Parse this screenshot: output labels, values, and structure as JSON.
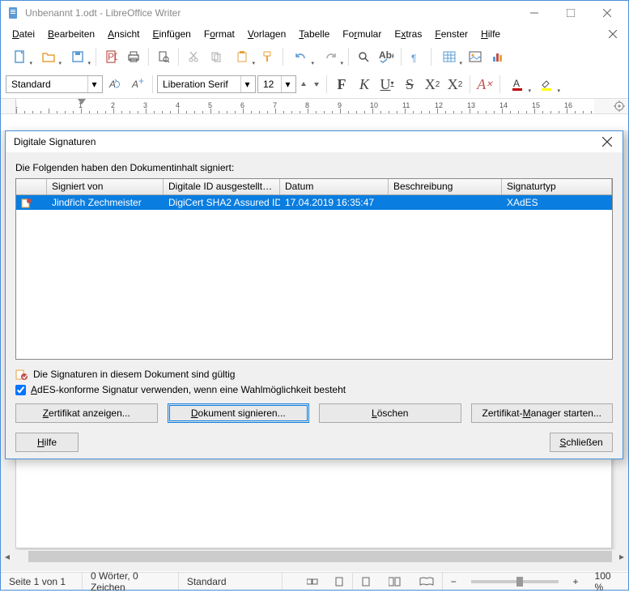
{
  "window": {
    "title": "Unbenannt 1.odt - LibreOffice Writer"
  },
  "menu": {
    "datei": "Datei",
    "bearbeiten": "Bearbeiten",
    "ansicht": "Ansicht",
    "einfuegen": "Einfügen",
    "format": "Format",
    "vorlagen": "Vorlagen",
    "tabelle": "Tabelle",
    "formular": "Formular",
    "extras": "Extras",
    "fenster": "Fenster",
    "hilfe": "Hilfe"
  },
  "formatting": {
    "para_style": "Standard",
    "font_name": "Liberation Serif",
    "font_size": "12"
  },
  "ruler_numbers": [
    "1",
    "",
    "1",
    "2",
    "3",
    "4",
    "5",
    "6",
    "7",
    "8",
    "9",
    "10",
    "11",
    "12",
    "13",
    "14",
    "15",
    "16"
  ],
  "dialog": {
    "title": "Digitale Signaturen",
    "intro": "Die Folgenden haben den Dokumentinhalt signiert:",
    "columns": {
      "signed_by": "Signiert von",
      "issuer": "Digitale ID ausgestellt du...",
      "date": "Datum",
      "desc": "Beschreibung",
      "type": "Signaturtyp"
    },
    "rows": [
      {
        "signed_by": "Jindřich Zechmeister",
        "issuer": "DigiCert SHA2 Assured ID",
        "date": "17.04.2019 16:35:47",
        "desc": "",
        "type": "XAdES"
      }
    ],
    "valid_status": "Die Signaturen in diesem Dokument sind gültig",
    "ades_checkbox": "AdES-konforme Signatur verwenden, wenn eine Wahlmöglichkeit besteht",
    "btn_view_cert": "Zertifikat anzeigen...",
    "btn_sign": "Dokument signieren...",
    "btn_delete": "Löschen",
    "btn_cert_mgr": "Zertifikat-Manager starten...",
    "btn_help": "Hilfe",
    "btn_close": "Schließen"
  },
  "statusbar": {
    "page": "Seite 1 von 1",
    "words": "0 Wörter, 0 Zeichen",
    "style": "Standard",
    "zoom_pct": "100 %"
  }
}
